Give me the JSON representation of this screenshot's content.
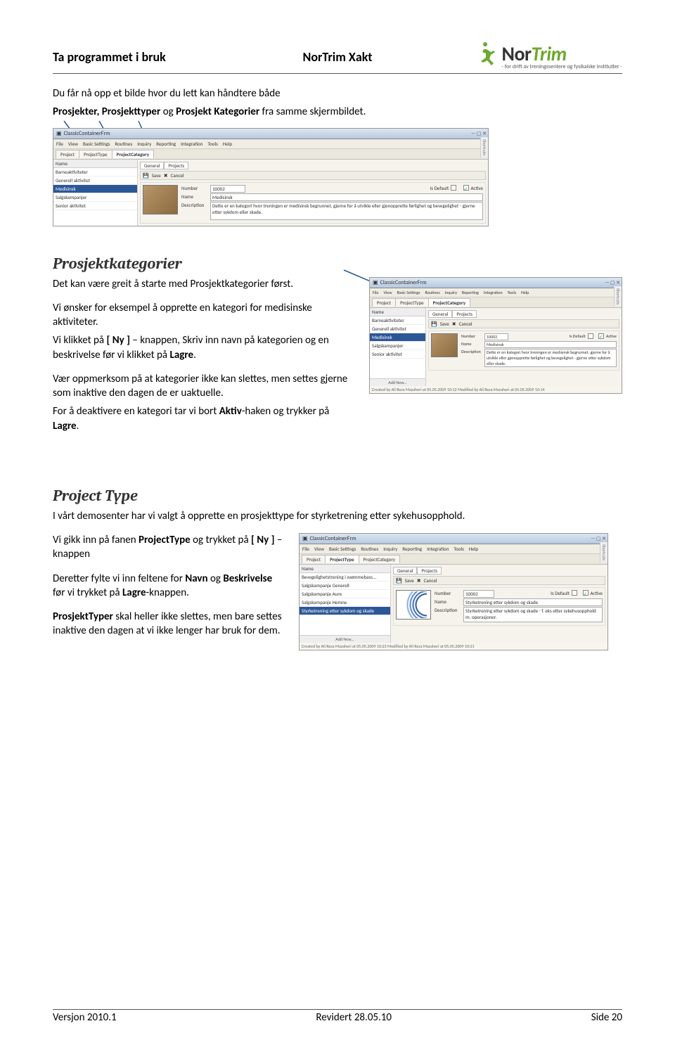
{
  "header": {
    "left": "Ta programmet i bruk",
    "center": "NorTrim Xakt",
    "logo_brand_a": "Nor",
    "logo_brand_b": "Trim",
    "logo_sub": "- for drift av treningssentere og fysikalske institutter -"
  },
  "intro1": "Du får nå opp et bilde hvor du lett kan håndtere både",
  "intro2_parts": [
    "Prosjekter, Prosjekttyper ",
    "og",
    " Prosjekt Kategorier ",
    "fra samme skjermbildet."
  ],
  "screenshot1": {
    "title": "ClassicContainerFrm",
    "menu": [
      "File",
      "View",
      "Basic Settings",
      "Routines",
      "Inquiry",
      "Reporting",
      "Integration",
      "Tools",
      "Help"
    ],
    "tabs": [
      "Project",
      "ProjectType",
      "ProjectCategory"
    ],
    "list_head": "Name",
    "list": [
      "Barneaktiviteter",
      "Generell aktivitet",
      "Medisinsk",
      "Salgskampanjer",
      "Senior aktivitet"
    ],
    "selected_index": 2,
    "inner_tabs": [
      "General",
      "Projects"
    ],
    "toolbar": [
      "Save",
      "Cancel"
    ],
    "fields": {
      "number_label": "Number",
      "number": "10002",
      "isdefault_label": "Is Default",
      "active_label": "Active",
      "name_label": "Name",
      "name": "Medisinsk",
      "desc_label": "Description",
      "desc": "Dette er en kategori hvor treningen er medisinsk begrunnet, gjerne for å utvikle eller gjenopprette førlighet og bevegelighet - gjerne etter sykdom eller skade."
    },
    "shortcuts": "Shortcuts"
  },
  "section1_h": "Prosjektkategorier",
  "section1_p1": "Det kan være greit å starte med Prosjektkategorier først.",
  "section1_p2": "Vi ønsker for eksempel å opprette en kategori for medisinske aktiviteter.",
  "section1_p3_pre": "Vi klikket på ",
  "section1_p3_b1": "[ Ny ]",
  "section1_p3_mid": " – knappen, Skriv inn navn på kategorien og en beskrivelse før vi klikket på ",
  "section1_p3_b2": "Lagre",
  "section1_p3_end": ".",
  "section1_p4": "Vær oppmerksom på at kategorier ikke kan slettes, men settes gjerne som inaktive den dagen de er uaktuelle.",
  "section1_p5_pre": "For å deaktivere en kategori tar vi bort ",
  "section1_p5_b": "Aktiv",
  "section1_p5_mid": "-haken og trykker på ",
  "section1_p5_b2": "Lagre",
  "section1_p5_end": ".",
  "screenshot2": {
    "title": "ClassicContainerFrm",
    "menu": [
      "File",
      "View",
      "Basic Settings",
      "Routines",
      "Inquiry",
      "Reporting",
      "Integration",
      "Tools",
      "Help"
    ],
    "tabs": [
      "Project",
      "ProjectType",
      "ProjectCategory"
    ],
    "list_head": "Name",
    "list": [
      "Barneaktiviteter",
      "Generell aktivitet",
      "Medisinsk",
      "Salgskampanjer",
      "Senior aktivitet"
    ],
    "selected_index": 2,
    "inner_tabs": [
      "General",
      "Projects"
    ],
    "toolbar": [
      "Save",
      "Cancel"
    ],
    "fields": {
      "number_label": "Number",
      "number": "10002",
      "isdefault_label": "Is Default",
      "active_label": "Active",
      "name_label": "Name",
      "name": "Medisinsk",
      "desc_label": "Description",
      "desc": "Dette er en kategori hvor treningen er medisinsk begrunnet, gjerne for å utvikle eller gjenopprette førlighet og bevegelighet - gjerne etter sykdom eller skade."
    },
    "add_new": "Add New...",
    "status": "Created by Ali Reza Mazaheri at 05.05.2009 10:12   Modified by Ali Reza Mazaheri at 05.05.2009 10:14",
    "shortcuts": "Shortcuts"
  },
  "section2_h": "Project Type",
  "section2_p1": "I vårt demosenter har vi valgt å opprette en prosjekttype for styrketrening etter sykehusopphold.",
  "section2_p2_pre": "Vi gikk inn på fanen ",
  "section2_p2_b1": "ProjectType",
  "section2_p2_mid": " og trykket på ",
  "section2_p2_b2": "[ Ny ]",
  "section2_p2_end": " – knappen",
  "section2_p3_pre": "Deretter fylte vi inn feltene for ",
  "section2_p3_b1": "Navn",
  "section2_p3_m1": " og ",
  "section2_p3_b2": "Beskrivelse",
  "section2_p3_m2": " før vi trykket på ",
  "section2_p3_b3": "Lagre",
  "section2_p3_end": "-knappen.",
  "section2_p4_b": "ProsjektTyper",
  "section2_p4": " skal heller ikke slettes, men bare settes inaktive den dagen at vi ikke lenger har bruk for dem.",
  "screenshot3": {
    "title": "ClassicContainerFrm",
    "menu": [
      "File",
      "View",
      "Basic Settings",
      "Routines",
      "Inquiry",
      "Reporting",
      "Integration",
      "Tools",
      "Help"
    ],
    "tabs": [
      "Project",
      "ProjectType",
      "ProjectCategory"
    ],
    "list_head": "Name",
    "list": [
      "Bevegelighetstrening i svømmebass...",
      "Salgskampanje Generell",
      "Salgskampanje Aure",
      "Salgskampanje Hemne",
      "Styrketrening etter sykdom og skade"
    ],
    "selected_index": 4,
    "inner_tabs": [
      "General",
      "Projects"
    ],
    "toolbar": [
      "Save",
      "Cancel"
    ],
    "fields": {
      "number_label": "Number",
      "number": "10002",
      "isdefault_label": "Is Default",
      "active_label": "Active",
      "name_label": "Name",
      "name": "Styrketrening etter sykdom og skade",
      "desc_label": "Description",
      "desc": "Styrketrening etter sykdom og skade - f. eks etter sykehusopphold m. operasjoner."
    },
    "add_new": "Add New...",
    "status": "Created by Ali Reza Mazaheri at 05.05.2009 10:23   Modified by Ali Reza Mazaheri at 05.05.2009 10:21",
    "shortcuts": "Shortcuts"
  },
  "footer": {
    "left": "Versjon 2010.1",
    "center": "Revidert 28.05.10",
    "right": "Side 20"
  }
}
